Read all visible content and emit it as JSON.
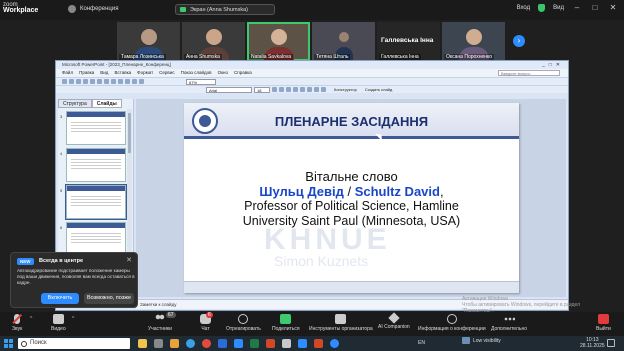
{
  "zoom": {
    "logo_top": "zoom",
    "logo_bottom": "Workplace",
    "conference_label": "Конференция",
    "share_banner": "Экран (Anna Shumska)",
    "login_label": "Вход",
    "view_label": "Вид"
  },
  "participants": [
    {
      "name": "Тамара Лозинська",
      "active": false
    },
    {
      "name": "Анна Shumska",
      "active": false
    },
    {
      "name": "Natalia Savkalova",
      "active": true
    },
    {
      "name": "Тетяна Шталь",
      "active": false
    },
    {
      "name": "Галлевська Інна",
      "active": false,
      "big_name": "Галлевська Інна"
    },
    {
      "name": "Оксана Порохненко",
      "active": false
    }
  ],
  "powerpoint": {
    "window_title": "Microsoft PowerPoint - [2023_Пленарне_Конференц]",
    "menu": [
      "Файл",
      "Правка",
      "Вид",
      "Вставка",
      "Формат",
      "Сервис",
      "Показ слайдов",
      "Окно",
      "Справка"
    ],
    "question_placeholder": "Введите вопрос",
    "zoom_value": "67%",
    "font_name": "Arial",
    "font_size": "18",
    "designer_label": "Конструктор",
    "new_slide_label": "Создать слайд",
    "tabs": [
      "Структура",
      "Слайды"
    ],
    "slide_numbers": [
      "3",
      "4",
      "5",
      "6",
      "7"
    ],
    "notes_placeholder": "Заметки к слайду",
    "slide": {
      "title": "ПЛЕНАРНЕ ЗАСІДАННЯ",
      "line1": "Вітальне слово",
      "name_ua": "Шульц Девід",
      "name_sep": " / ",
      "name_en": "Schultz David",
      "name_comma": ",",
      "line3": "Professor of Political Science, Hamline",
      "line4": "University Saint Paul (Minnesota, USA)",
      "watermark1": "KHNUE",
      "watermark2": "Simon Kuznets"
    }
  },
  "windows_activation": {
    "line1": "Активация Windows",
    "line2": "Чтобы активировать Windows, перейдите в раздел",
    "line3": "\"Параметры\"."
  },
  "popup": {
    "badge": "NEW",
    "title": "Всегда в центре",
    "text": "Автокадрирование подстраивает положение камеры под ваши движения, позволяя вам всегда оставаться в кадре.",
    "enable_label": "Включить",
    "later_label": "Возможно, позже"
  },
  "toolbar": {
    "audio_label": "Звук",
    "video_label": "Видео",
    "participants_label": "Участники",
    "participants_count": "67",
    "chat_label": "Чат",
    "chat_badge": "6",
    "react_label": "Отреагировать",
    "share_label": "Поделиться",
    "host_tools_label": "Инструменты организатора",
    "ai_label": "AI Companion",
    "info_label": "Информация о конференции",
    "more_label": "Дополнительно",
    "exit_label": "Выйти"
  },
  "taskbar": {
    "search_placeholder": "Поиск",
    "lang": "EN",
    "status": "Low visibility",
    "time": "10:13",
    "date": "28.11.2025"
  },
  "colors": {
    "accent_blue": "#2d8cff",
    "active_green": "#3fc96e",
    "slide_title": "#1c2f6e",
    "speaker_name": "#1a46c8"
  }
}
